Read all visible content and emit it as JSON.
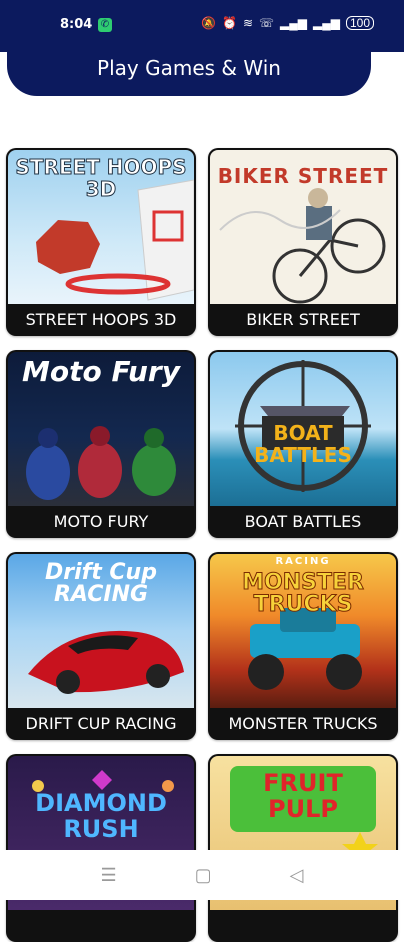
{
  "status_bar": {
    "time": "8:04",
    "call_icon": "phone-icon",
    "battery": "100"
  },
  "header": {
    "title": "Play Games & Win"
  },
  "games": [
    {
      "label": "STREET HOOPS 3D",
      "art_title": "STREET HOOPS\n3D"
    },
    {
      "label": "BIKER STREET",
      "art_title": "BIKER STREET"
    },
    {
      "label": "MOTO FURY",
      "art_title": "Moto Fury"
    },
    {
      "label": "BOAT BATTLES",
      "art_title": "BOAT\nBATTLES"
    },
    {
      "label": "DRIFT CUP RACING",
      "art_title": "Drift Cup\nRACING"
    },
    {
      "label": "MONSTER TRUCKS",
      "art_title": "MONSTER\nTRUCKS"
    },
    {
      "label": "",
      "art_title": "DIAMOND\nRUSH"
    },
    {
      "label": "",
      "art_title": "FRUIT\nPULP"
    }
  ],
  "monster_racing_tag": "RACING",
  "colors": {
    "header_bg": "#0c1a5e",
    "card_bg": "#111111",
    "page_bg": "#ffffff"
  }
}
